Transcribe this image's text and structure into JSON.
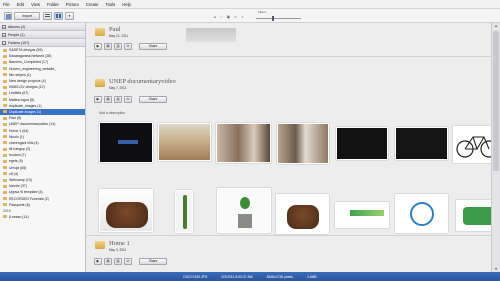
{
  "menu": [
    "File",
    "Edit",
    "View",
    "Folder",
    "Picture",
    "Create",
    "Tools",
    "Help"
  ],
  "toolbar": {
    "import_label": "Import",
    "filters_label": "Filters"
  },
  "sidebar": {
    "groups": [
      {
        "label": "Albums (2)"
      },
      {
        "label": "People (1)"
      },
      {
        "label": "Folders (107)"
      }
    ],
    "items": [
      "SASETA designs (59)",
      "Kasaragwana Network (28)",
      "Banners_Completed (17)",
      "Huvero_engineering_website_",
      "film stripes (1)",
      "New design projects (4)",
      "KIMELOV designs (12)",
      "Leaflets (67)",
      "Mattea logos (8)",
      "duplicate_images (1)",
      "Duplicate images (1)",
      "Paul (8)",
      "UNEP documentaryvideo (14)",
      "Home 1 (64)",
      "Nicolo (1)",
      "cherengani hills (4)",
      "fill hangup (2)",
      "boutani (7)",
      "egets (5)",
      "Umoja (65)",
      "c8 (4)",
      "Webcamp (10)",
      "Nzioke (37)",
      "Uppsa 9I template (4)",
      "RECORDED Funerals (2)",
      "Passports (6)"
    ],
    "selected_index": 10,
    "year_label": "2010",
    "last_item": "6-seaso (14)"
  },
  "albums": [
    {
      "title": "Paul",
      "date": "May 12, 2011",
      "share": "Share"
    },
    {
      "title": "UNEP documentaryvideo",
      "date": "May 7, 2011",
      "share": "Share",
      "description_placeholder": "Add a description"
    },
    {
      "title": "Home 1",
      "date": "May 3, 2011",
      "share": "Share"
    }
  ],
  "thumbnail_icons": [
    "dark-video-thumb",
    "landscape-photo",
    "people-photo",
    "children-photo",
    "black-frame",
    "black-frame",
    "bicycle-image",
    "cake-photo",
    "plant-seedling",
    "tree-stump",
    "cake-photo-2",
    "green-logo",
    "blue-40-logo",
    "green-economy-logo"
  ],
  "status": {
    "filename": "DSC07435.JPG",
    "datetime": "2/3/2011 8:53:37 AM",
    "dimensions": "3648x2736 pixels",
    "size": "4.6MB"
  },
  "colors": {
    "selection": "#3b72c8",
    "statusbar": "#2f5ea9",
    "folder": "#e3b55a"
  }
}
